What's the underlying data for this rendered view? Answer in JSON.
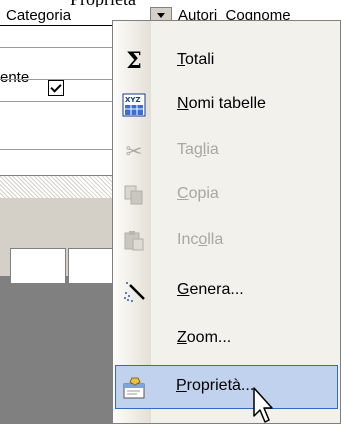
{
  "top_fragment": "Proprietà",
  "grid": {
    "col1_header": "Categoria",
    "col2_header": "Autori_Cognome",
    "row_label": "ente"
  },
  "menu": {
    "items": [
      {
        "id": "totali",
        "icon": "sigma-icon",
        "pre": "",
        "acc": "T",
        "post": "otali",
        "disabled": false
      },
      {
        "id": "nomi-tabelle",
        "icon": "xyz-table-icon",
        "pre": "",
        "acc": "N",
        "post": "omi tabelle",
        "disabled": false
      },
      {
        "id": "taglia",
        "icon": "scissors-icon",
        "pre": "Tag",
        "acc": "l",
        "post": "ia",
        "disabled": true
      },
      {
        "id": "copia",
        "icon": "copy-icon",
        "pre": "",
        "acc": "C",
        "post": "opia",
        "disabled": true
      },
      {
        "id": "incolla",
        "icon": "paste-icon",
        "pre": "Inc",
        "acc": "o",
        "post": "lla",
        "disabled": true
      },
      {
        "id": "genera",
        "icon": "wand-icon",
        "pre": "",
        "acc": "G",
        "post": "enera...",
        "disabled": false
      },
      {
        "id": "zoom",
        "icon": "",
        "pre": "",
        "acc": "Z",
        "post": "oom...",
        "disabled": false
      },
      {
        "id": "proprieta",
        "icon": "properties-icon",
        "pre": "",
        "acc": "P",
        "post": "roprietà...",
        "disabled": false
      }
    ]
  },
  "colors": {
    "highlight": "#c1d2ee",
    "highlight_border": "#316ac5",
    "menu_bg": "#f2f1ec"
  }
}
